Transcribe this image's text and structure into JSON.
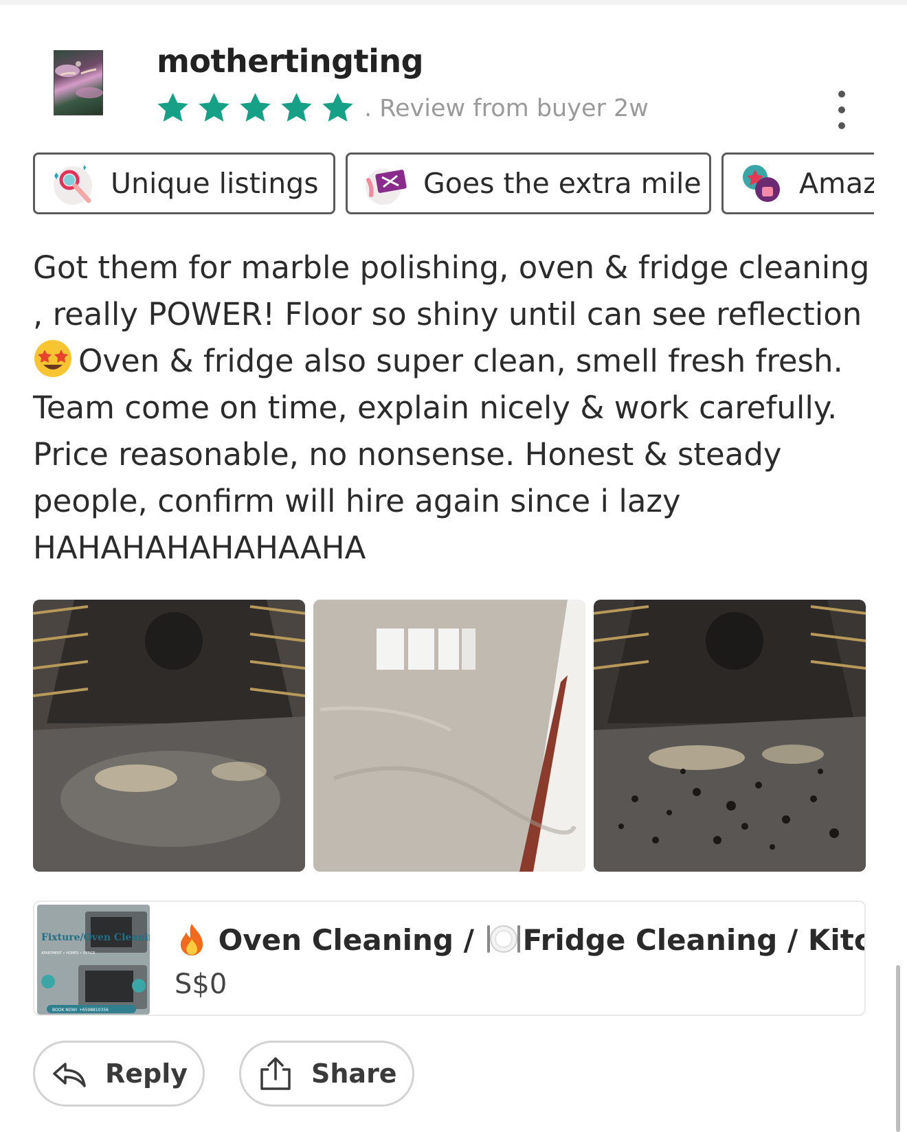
{
  "review": {
    "username": "mothertingting",
    "rating": 5,
    "rating_max": 5,
    "meta": ". Review from buyer  2w",
    "more_icon": "more-vertical-icon",
    "star_color": "#16a085",
    "tags": [
      {
        "label": "Unique listings",
        "icon": "magnifier-sparkle-icon"
      },
      {
        "label": "Goes the extra mile",
        "icon": "ticket-icon"
      },
      {
        "label": "Amaz",
        "icon": "thumbs-up-star-icon"
      }
    ],
    "text_before_emoji": "Got them for marble polishing, oven & fridge cleaning , really POWER! Floor so shiny until can see reflection",
    "emoji": "star-struck-emoji",
    "text_after_emoji": "Oven & fridge also super clean, smell fresh fresh. Team come on time, explain nicely & work carefully. Price reasonable, no nonsense. Honest & steady people, confirm will hire again since i lazy HAHAHAHAHAHAAHA",
    "photos": [
      "clean-oven-photo",
      "polished-marble-floor-photo",
      "dirty-oven-photo"
    ]
  },
  "listing": {
    "title": "Oven Cleaning / ",
    "title_after_icon": "Fridge Cleaning / Kitc...",
    "fire_icon": "fire-icon",
    "plate_icon": "plate-cutlery-icon",
    "price": "S$0",
    "thumb_title": "Fixture/Oven Cleaning",
    "thumb_sub": "APARTMENT • HOMES • OFFICE",
    "thumb_cta": "BOOK NOW! +6598810356"
  },
  "actions": {
    "reply_label": "Reply",
    "share_label": "Share"
  }
}
